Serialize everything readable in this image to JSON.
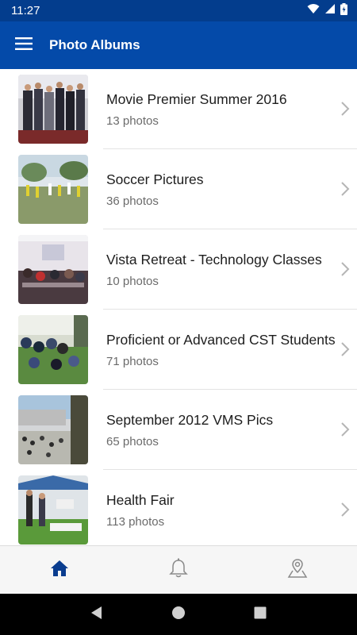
{
  "status_bar": {
    "time": "11:27"
  },
  "app_bar": {
    "title": "Photo Albums"
  },
  "albums": [
    {
      "title": "Movie Premier Summer 2016",
      "count": "13 photos"
    },
    {
      "title": "Soccer Pictures",
      "count": "36 photos"
    },
    {
      "title": "Vista Retreat - Technology Classes",
      "count": "10 photos"
    },
    {
      "title": "Proficient or Advanced CST Students",
      "count": "71 photos"
    },
    {
      "title": "September 2012 VMS Pics",
      "count": "65 photos"
    },
    {
      "title": "Health Fair",
      "count": "113 photos"
    }
  ],
  "bottom_nav": [
    {
      "icon": "home-icon",
      "active": true
    },
    {
      "icon": "bell-icon",
      "active": false
    },
    {
      "icon": "map-pin-icon",
      "active": false
    }
  ],
  "colors": {
    "status_bar": "#033d8d",
    "app_bar": "#044aa9",
    "accent": "#0a3d8f",
    "inactive_icon": "#8a8a8a"
  }
}
